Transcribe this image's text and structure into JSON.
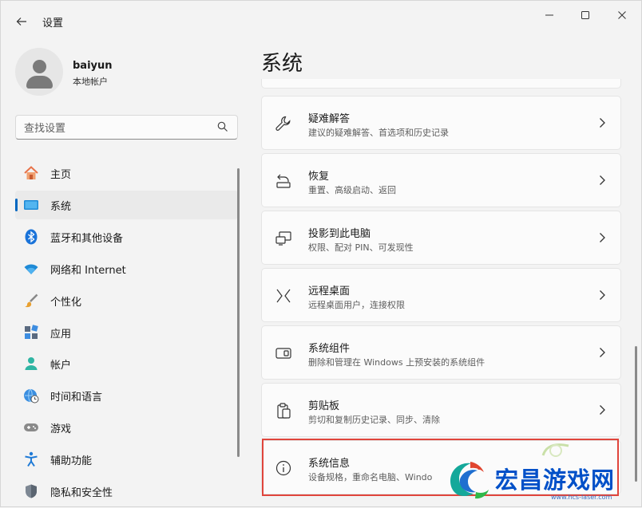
{
  "app": {
    "title": "设置"
  },
  "window_controls": {
    "minimize_icon": "minimize-icon",
    "maximize_icon": "maximize-icon",
    "close_icon": "close-icon"
  },
  "profile": {
    "name": "baiyun",
    "account_type": "本地帐户"
  },
  "search": {
    "placeholder": "查找设置"
  },
  "sidebar": {
    "items": [
      {
        "label": "主页",
        "icon": "home-icon",
        "selected": false
      },
      {
        "label": "系统",
        "icon": "system-icon",
        "selected": true
      },
      {
        "label": "蓝牙和其他设备",
        "icon": "bluetooth-icon",
        "selected": false
      },
      {
        "label": "网络和 Internet",
        "icon": "wifi-icon",
        "selected": false
      },
      {
        "label": "个性化",
        "icon": "brush-icon",
        "selected": false
      },
      {
        "label": "应用",
        "icon": "apps-icon",
        "selected": false
      },
      {
        "label": "帐户",
        "icon": "account-icon",
        "selected": false
      },
      {
        "label": "时间和语言",
        "icon": "globe-clock-icon",
        "selected": false
      },
      {
        "label": "游戏",
        "icon": "gamepad-icon",
        "selected": false
      },
      {
        "label": "辅助功能",
        "icon": "accessibility-icon",
        "selected": false
      },
      {
        "label": "隐私和安全性",
        "icon": "shield-icon",
        "selected": false
      }
    ]
  },
  "main": {
    "title": "系统",
    "cards": [
      {
        "title": "疑难解答",
        "desc": "建议的疑难解答、首选项和历史记录",
        "icon": "wrench-icon"
      },
      {
        "title": "恢复",
        "desc": "重置、高级启动、返回",
        "icon": "recovery-icon"
      },
      {
        "title": "投影到此电脑",
        "desc": "权限、配对 PIN、可发现性",
        "icon": "project-icon"
      },
      {
        "title": "远程桌面",
        "desc": "远程桌面用户，连接权限",
        "icon": "remote-desktop-icon"
      },
      {
        "title": "系统组件",
        "desc": "删除和管理在 Windows 上预安装的系统组件",
        "icon": "components-icon"
      },
      {
        "title": "剪贴板",
        "desc": "剪切和复制历史记录、同步、清除",
        "icon": "clipboard-icon"
      },
      {
        "title": "系统信息",
        "desc": "设备规格，重命名电脑、Windo",
        "icon": "info-icon"
      }
    ]
  },
  "watermark": {
    "text": "宏昌游戏网",
    "url": "www.hcs-laser.com"
  },
  "colors": {
    "accent": "#0067c0",
    "highlight": "#e0453c",
    "background": "#f3f3f3",
    "card": "#fbfbfb",
    "watermark": "#0050c8"
  }
}
